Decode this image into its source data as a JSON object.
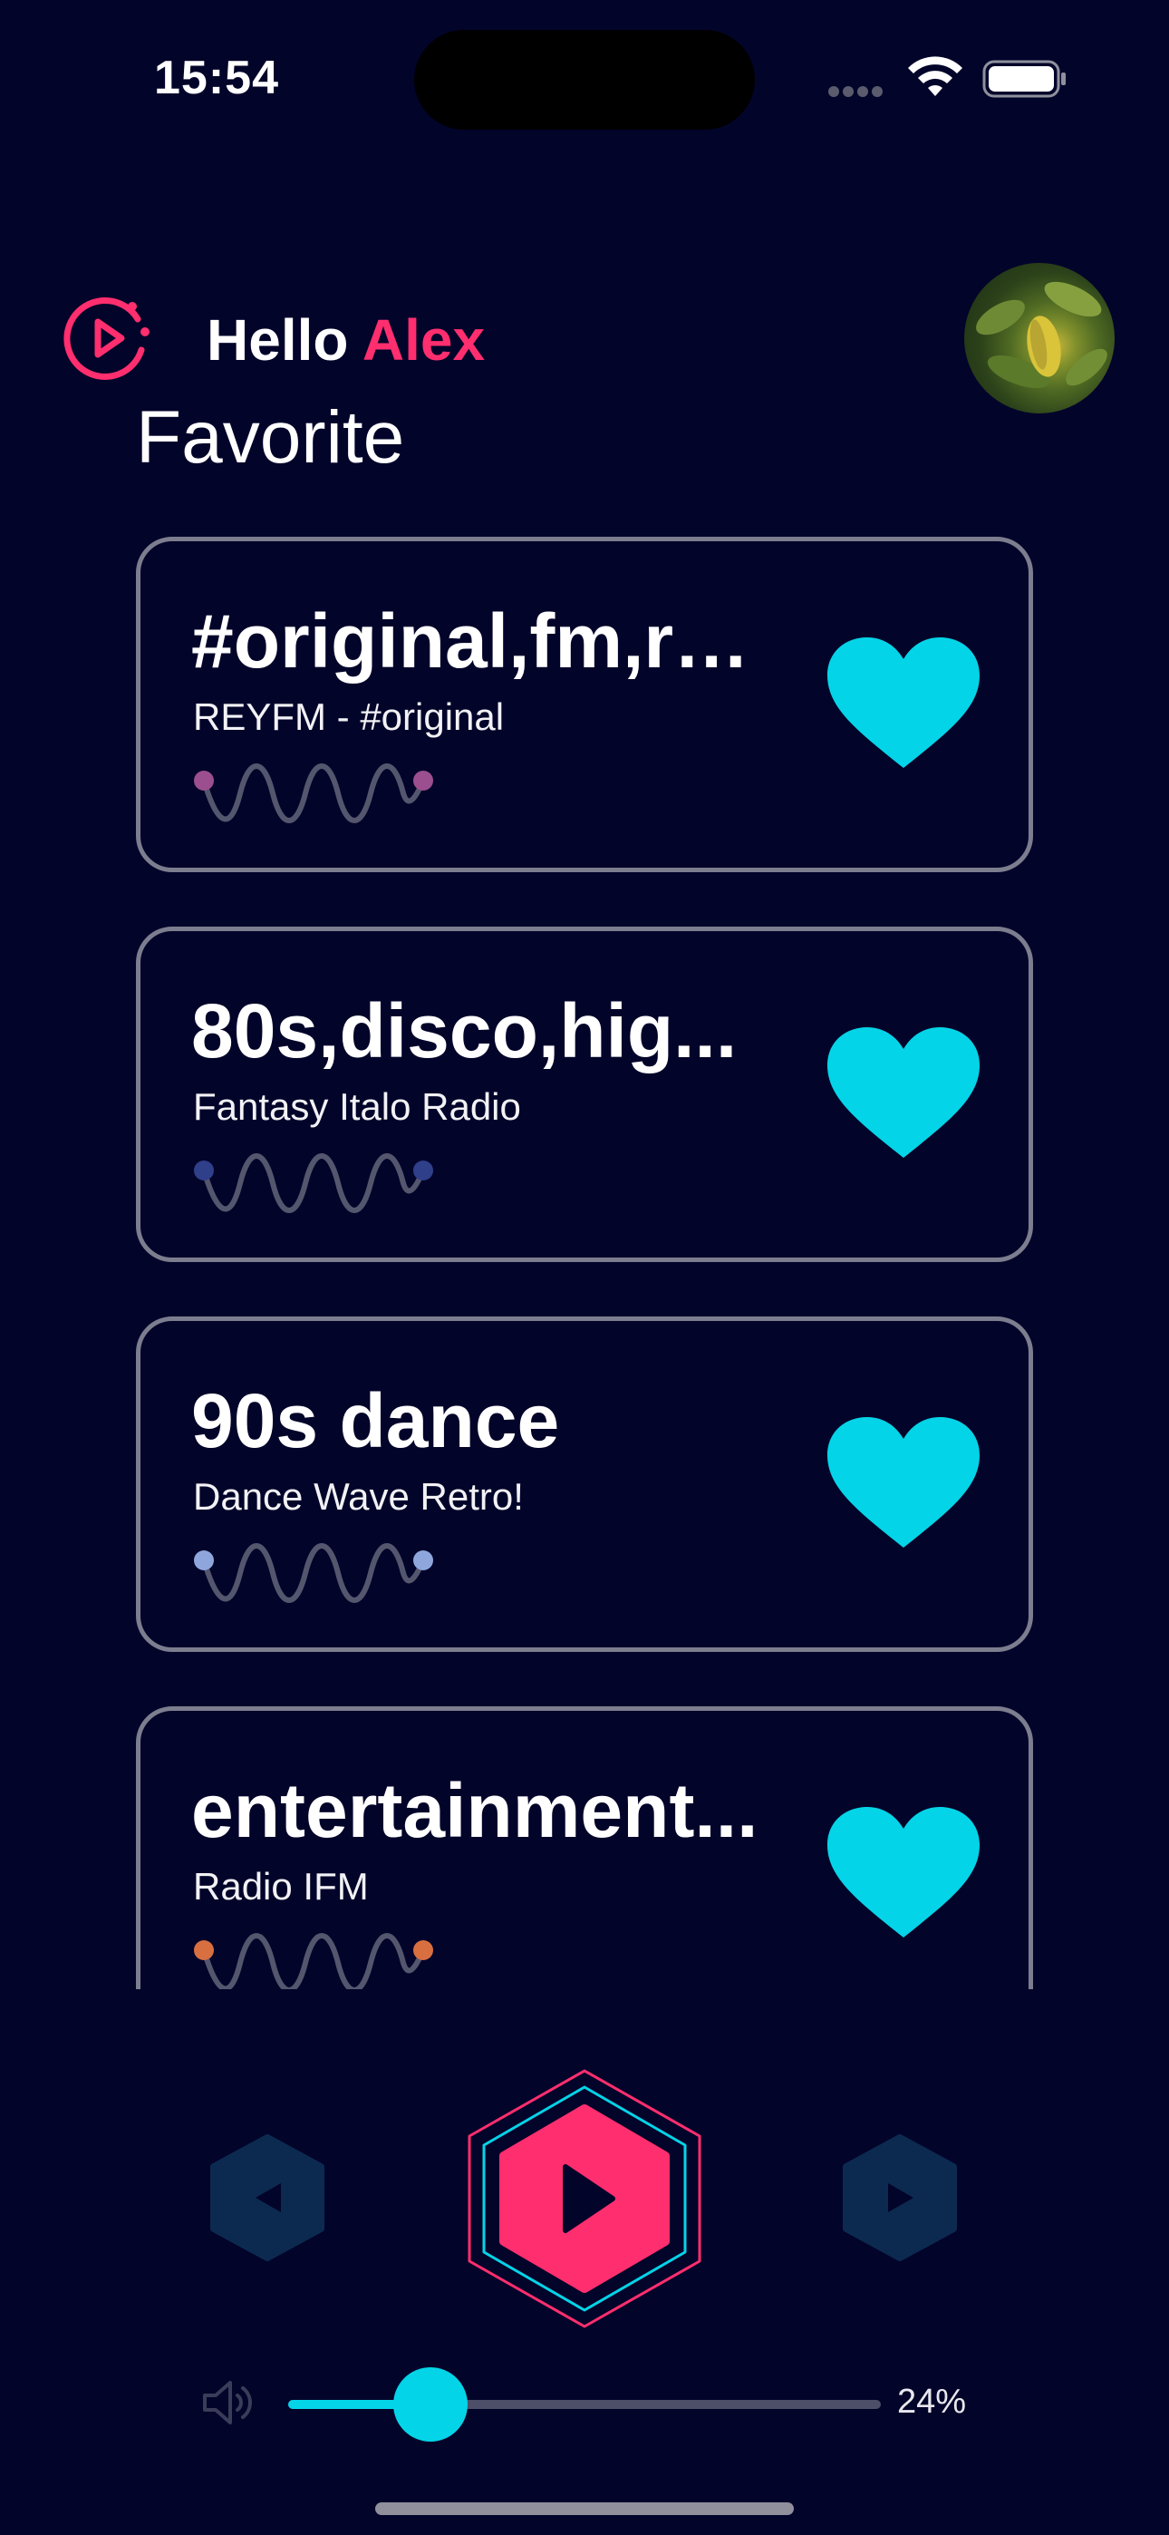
{
  "status_bar": {
    "time": "15:54",
    "icons": [
      "cellular-signal-icon",
      "wifi-icon",
      "battery-icon"
    ]
  },
  "header": {
    "logo_icon": "play-logo-icon",
    "greeting_prefix": "Hello",
    "user_name": "Alex",
    "avatar": "user-avatar-photo"
  },
  "page_title": "Favorite",
  "favorites": [
    {
      "title": "#original,fm,re...",
      "subtitle": "REYFM - #original",
      "favorited": true,
      "wave_dot_color": "#9b4f8f"
    },
    {
      "title": "80s,disco,hig...",
      "subtitle": "Fantasy Italo Radio",
      "favorited": true,
      "wave_dot_color": "#2f3f8a"
    },
    {
      "title": "90s dance",
      "subtitle": "Dance Wave Retro!",
      "favorited": true,
      "wave_dot_color": "#8ea6dc"
    },
    {
      "title": "entertainment...",
      "subtitle": "Radio IFM",
      "favorited": true,
      "wave_dot_color": "#d86f40"
    }
  ],
  "player": {
    "previous_icon": "previous-icon",
    "play_icon": "play-icon",
    "next_icon": "next-icon"
  },
  "volume": {
    "icon": "speaker-icon",
    "percent": 24,
    "label": "24%"
  },
  "colors": {
    "background": "#03042a",
    "accent_pink": "#ff2e6e",
    "accent_cyan": "#04d4e8",
    "card_border": "#7c7e8f",
    "control_dark": "#0c2a50"
  }
}
